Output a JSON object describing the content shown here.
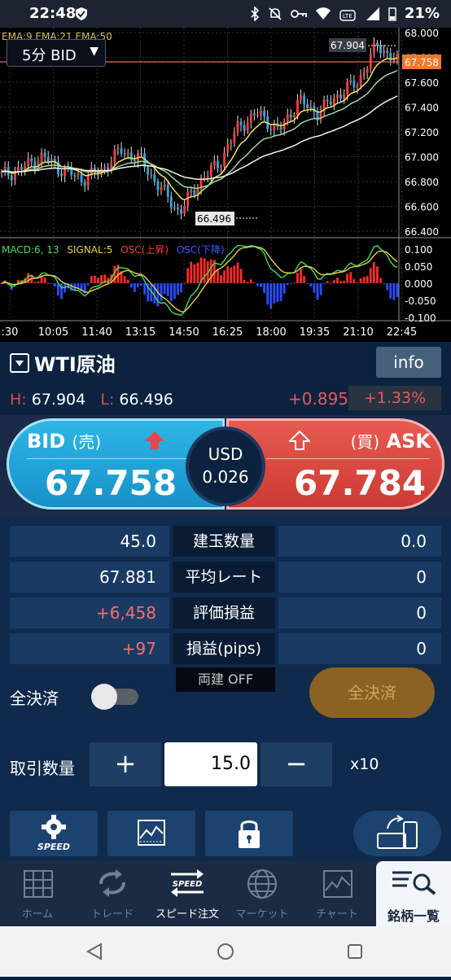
{
  "status_bar": {
    "time": "22:48",
    "battery": "21%"
  },
  "chart": {
    "timeframe": "5分 BID",
    "ema_label": "EMA:9  EMA:21  EMA:50",
    "y_labels": [
      "68.000",
      "67.800",
      "67.600",
      "67.400",
      "67.200",
      "67.000",
      "66.800",
      "66.600",
      "66.400"
    ],
    "high_tag": "67.904",
    "low_tag": "66.496",
    "current_tag": "67.758",
    "macd_legend": {
      "macd": "MACD:6, 13",
      "signal": "SIGNAL:5",
      "osc_up": "OSC(上昇)",
      "osc_down": "OSC(下降)"
    },
    "macd_y_labels": [
      "0.100",
      "0.050",
      "0.000",
      "-0.050",
      "-0.100"
    ],
    "x_labels": [
      ":30",
      "10:05",
      "11:40",
      "13:15",
      "14:50",
      "16:25",
      "18:00",
      "19:35",
      "21:10",
      "22:45"
    ]
  },
  "chart_data": {
    "type": "candlestick",
    "ylim": [
      66.4,
      68.0
    ],
    "times": [
      ":30",
      "10:05",
      "11:40",
      "13:15",
      "14:50",
      "16:25",
      "18:00",
      "19:35",
      "21:10",
      "22:45"
    ],
    "close_profile": [
      66.85,
      66.9,
      67.0,
      66.9,
      66.82,
      66.88,
      67.05,
      66.98,
      66.75,
      66.55,
      66.8,
      66.95,
      67.25,
      67.35,
      67.2,
      67.45,
      67.35,
      67.5,
      67.6,
      67.904,
      67.758
    ],
    "high": 67.904,
    "low": 66.496,
    "current": 67.758
  },
  "instrument": {
    "name": "WTI原油",
    "info_label": "info",
    "high_label": "H:",
    "high_value": "67.904",
    "low_label": "L:",
    "low_value": "66.496",
    "change": "+0.895",
    "change_pct": "+1.33%"
  },
  "trade": {
    "bid_label": "BID",
    "bid_sub": "(売)",
    "bid_price": "67.758",
    "ask_label": "ASK",
    "ask_sub": "(買)",
    "ask_price": "67.784",
    "spread_currency": "USD",
    "spread_value": "0.026"
  },
  "positions": [
    {
      "left": "45.0",
      "label": "建玉数量",
      "right": "0.0"
    },
    {
      "left": "67.881",
      "label": "平均レート",
      "right": "0"
    },
    {
      "left": "+6,458",
      "label": "評価損益",
      "right": "0"
    },
    {
      "left": "+97",
      "label": "損益(pips)",
      "right": "0"
    }
  ],
  "controls": {
    "ryodate": "両建 OFF",
    "zenkessai_label": "全決済",
    "zenkessai_button": "全決済",
    "qty_label": "取引数量",
    "qty_value": "15.0",
    "multiplier": "x10",
    "speed_label": "SPEED"
  },
  "nav": {
    "home": "ホーム",
    "trade": "トレード",
    "speed_icon_label": "SPEED",
    "speed": "スピード注文",
    "market": "マーケット",
    "chart": "チャート",
    "list": "銘柄一覧"
  },
  "colors": {
    "bid": "#1e9fd6",
    "ask": "#dc463e",
    "background": "#0c2340"
  }
}
